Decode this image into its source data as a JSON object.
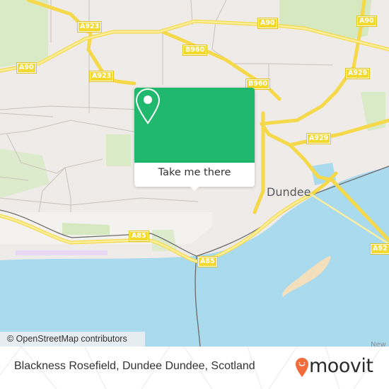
{
  "map": {
    "city_label": "Dundee",
    "partial_label": "New",
    "road_shields": [
      {
        "id": "a923-top",
        "label": "A923"
      },
      {
        "id": "a923-mid",
        "label": "A923"
      },
      {
        "id": "a90-left",
        "label": "A90"
      },
      {
        "id": "a90-center",
        "label": "A90"
      },
      {
        "id": "a90-right",
        "label": "A90"
      },
      {
        "id": "b960-top",
        "label": "B960"
      },
      {
        "id": "b960-mid",
        "label": "B960"
      },
      {
        "id": "a929-upper",
        "label": "A929"
      },
      {
        "id": "a929-lower",
        "label": "A929"
      },
      {
        "id": "a85-left",
        "label": "A85"
      },
      {
        "id": "a85-right",
        "label": "A85"
      },
      {
        "id": "a92",
        "label": "A92"
      }
    ],
    "colors": {
      "land": "#efebe8",
      "water": "#a9daee",
      "park": "#d5e8c0",
      "road": "#f7e27a",
      "sandbank": "#f4dfbd"
    },
    "attribution": "© OpenStreetMap contributors"
  },
  "popup": {
    "button_label": "Take me there",
    "icon": "map-pin-icon",
    "color": "#1fb86c"
  },
  "footer": {
    "address": "Blackness Rosefield, Dundee Dundee, Scotland",
    "brand": "moovit",
    "brand_color": "#f26b3a"
  }
}
